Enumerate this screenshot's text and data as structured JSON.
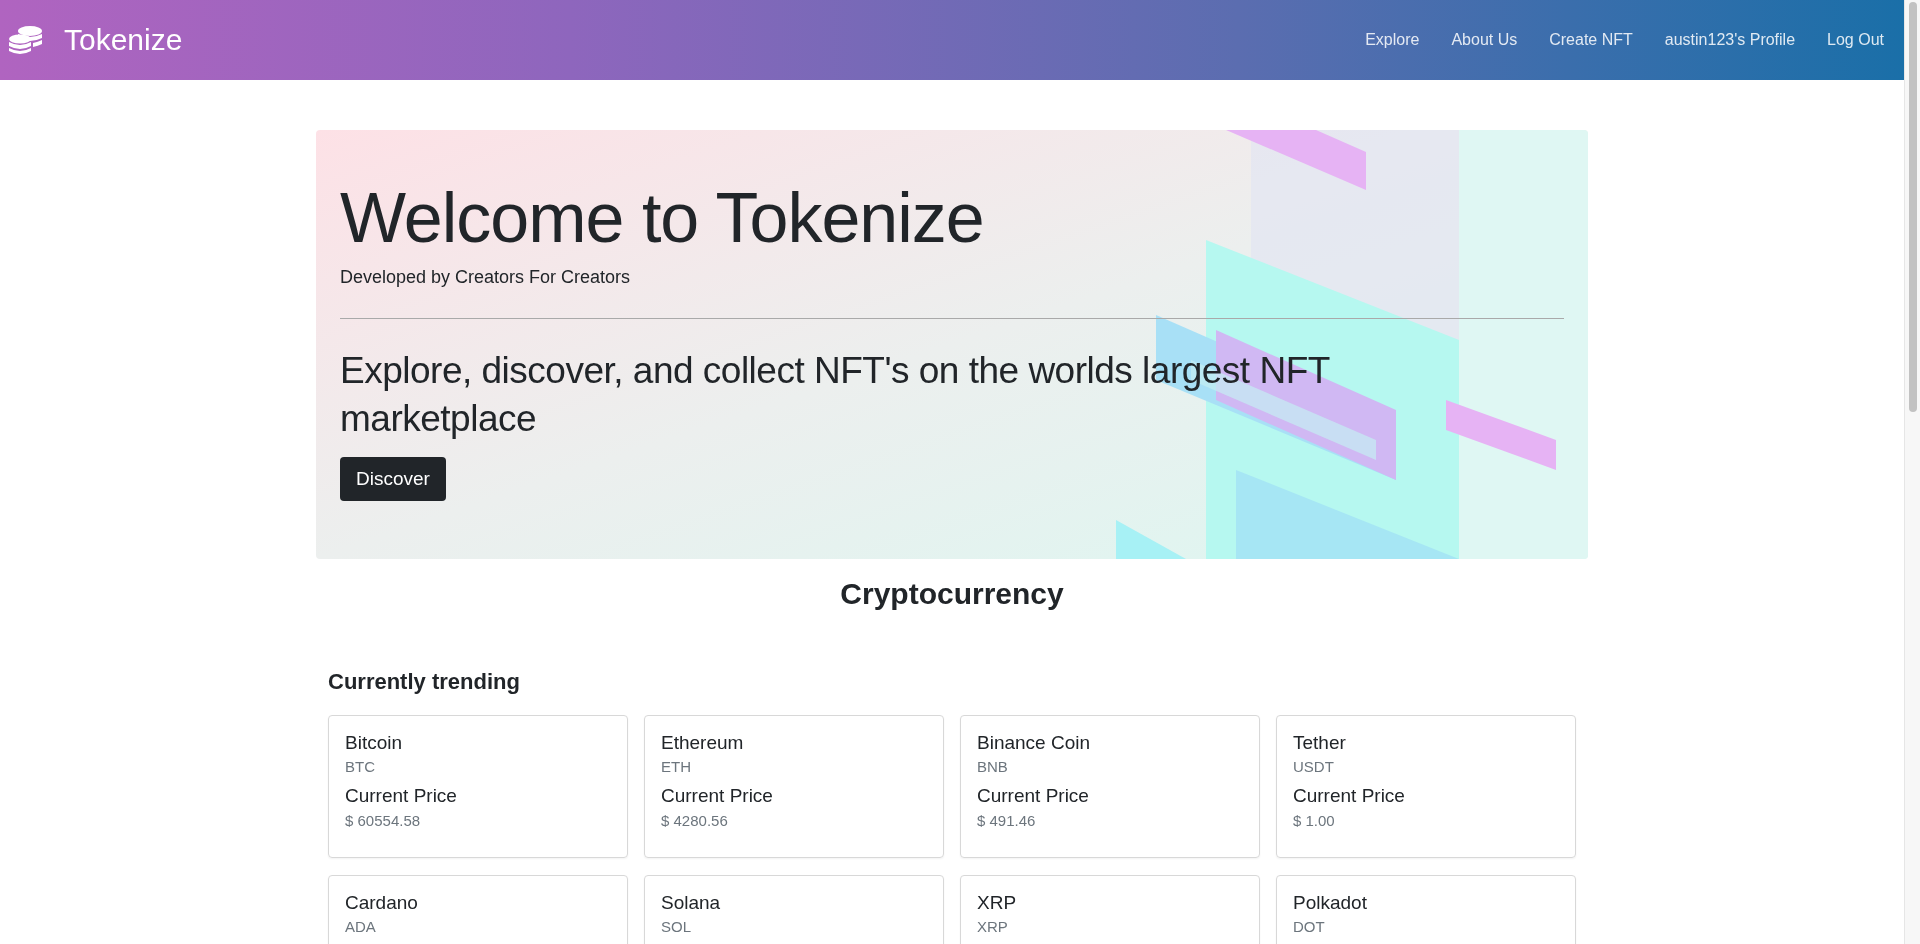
{
  "navbar": {
    "brand": "Tokenize",
    "links": [
      "Explore",
      "About Us",
      "Create NFT",
      "austin123's Profile",
      "Log Out"
    ]
  },
  "hero": {
    "title": "Welcome to Tokenize",
    "subtitle": "Developed by Creators For Creators",
    "lead": "Explore, discover, and collect NFT's on the worlds largest NFT marketplace",
    "button": "Discover"
  },
  "section_title": "Cryptocurrency",
  "trending": {
    "title": "Currently trending",
    "coins": [
      {
        "name": "Bitcoin",
        "symbol": "BTC",
        "price_label": "Current Price",
        "price": "$ 60554.58"
      },
      {
        "name": "Ethereum",
        "symbol": "ETH",
        "price_label": "Current Price",
        "price": "$ 4280.56"
      },
      {
        "name": "Binance Coin",
        "symbol": "BNB",
        "price_label": "Current Price",
        "price": "$ 491.46"
      },
      {
        "name": "Tether",
        "symbol": "USDT",
        "price_label": "Current Price",
        "price": "$ 1.00"
      },
      {
        "name": "Cardano",
        "symbol": "ADA"
      },
      {
        "name": "Solana",
        "symbol": "SOL"
      },
      {
        "name": "XRP",
        "symbol": "XRP"
      },
      {
        "name": "Polkadot",
        "symbol": "DOT"
      }
    ]
  }
}
